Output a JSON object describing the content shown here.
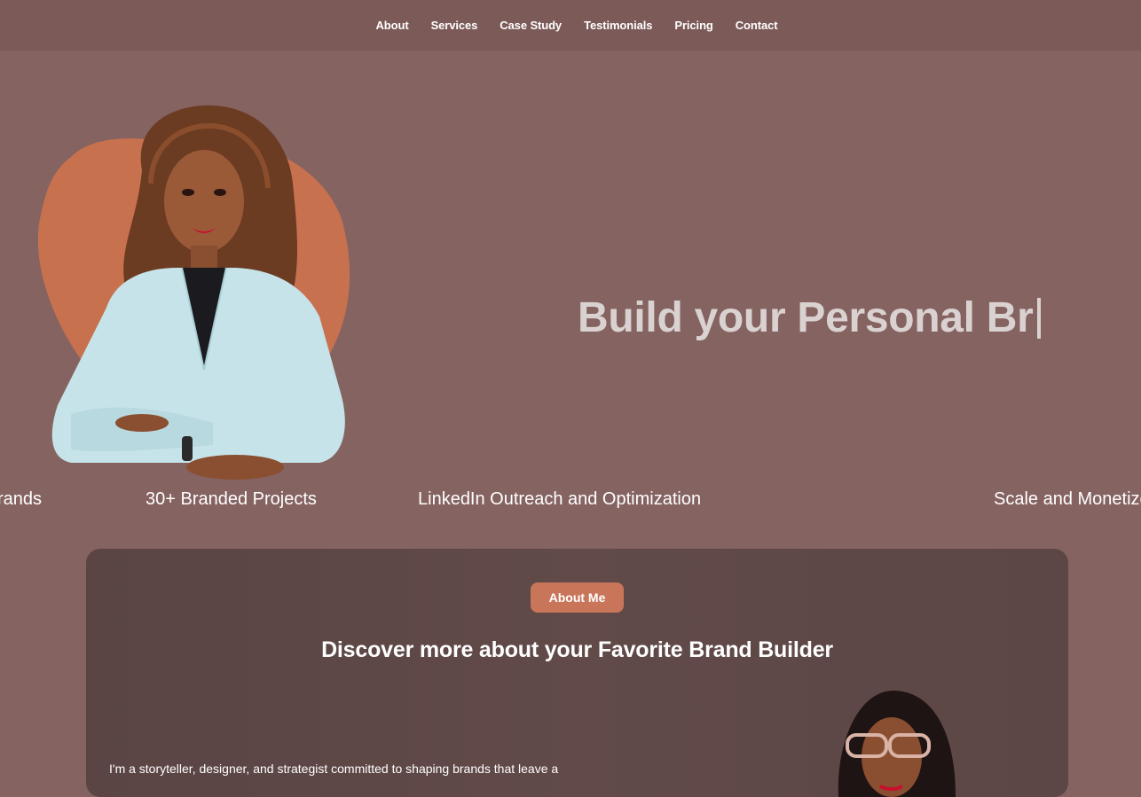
{
  "nav": {
    "items": [
      {
        "label": "About"
      },
      {
        "label": "Services"
      },
      {
        "label": "Case Study"
      },
      {
        "label": "Testimonials"
      },
      {
        "label": "Pricing"
      },
      {
        "label": "Contact"
      }
    ]
  },
  "hero": {
    "headline": "Build your Personal Br"
  },
  "marquee": {
    "items": [
      {
        "label": "rands"
      },
      {
        "label": "30+ Branded Projects"
      },
      {
        "label": "LinkedIn Outreach and Optimization"
      },
      {
        "label": "Scale and Monetize"
      }
    ]
  },
  "about": {
    "badge": "About Me",
    "title": "Discover more about your Favorite Brand Builder",
    "text": "I'm a storyteller, designer, and strategist committed to shaping brands that leave a"
  },
  "colors": {
    "page_bg": "#856361",
    "nav_bg": "#7b5a58",
    "accent": "#c8755a",
    "card_bg": "#5c4746",
    "headline": "#d9d2d1"
  }
}
